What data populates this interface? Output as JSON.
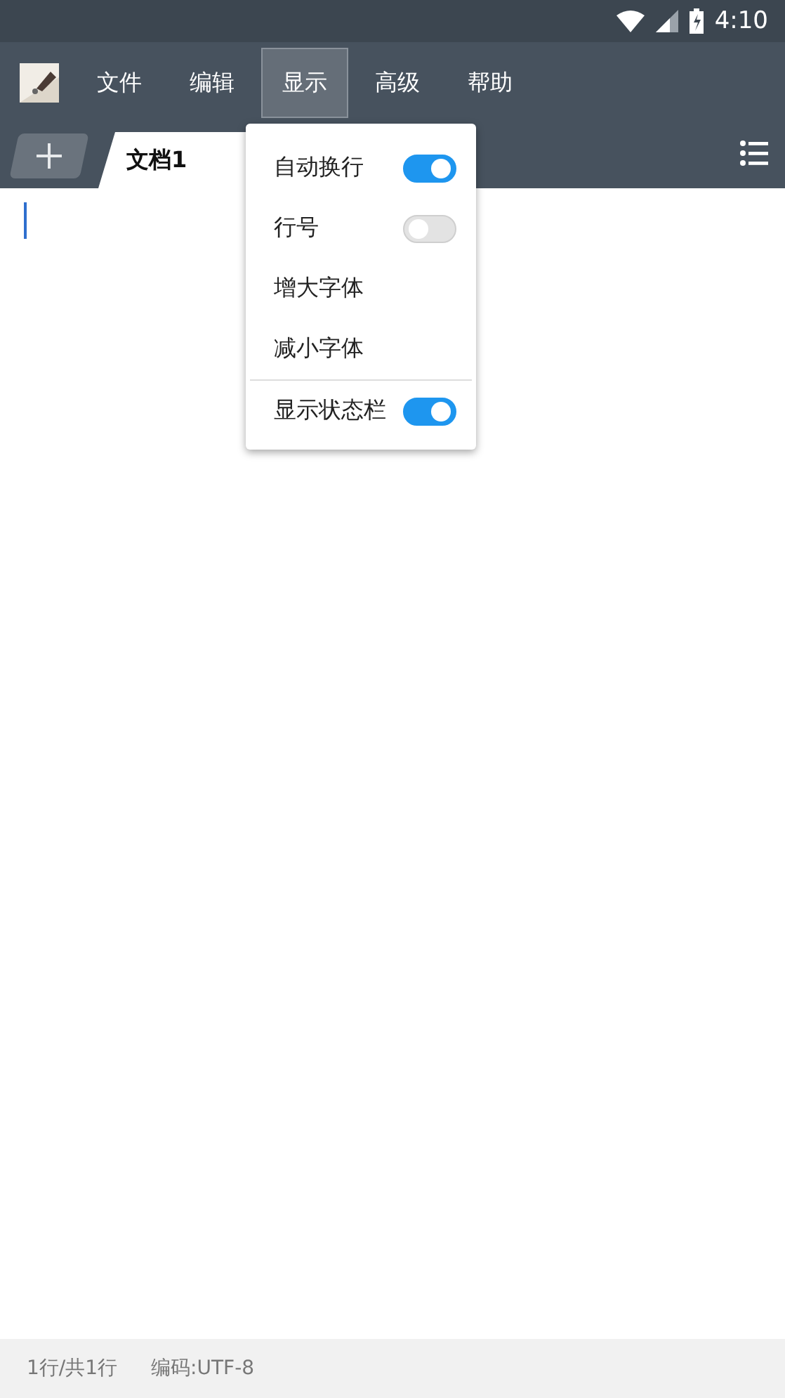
{
  "system_bar": {
    "time": "4:10"
  },
  "menu_bar": {
    "menus": [
      {
        "label": "文件",
        "selected": false
      },
      {
        "label": "编辑",
        "selected": false
      },
      {
        "label": "显示",
        "selected": true
      },
      {
        "label": "高级",
        "selected": false
      },
      {
        "label": "帮助",
        "selected": false
      }
    ]
  },
  "tabs": [
    {
      "label": "文档1",
      "selected": true
    }
  ],
  "dropdown": {
    "items": [
      {
        "kind": "toggle",
        "label": "自动换行",
        "on": true
      },
      {
        "kind": "toggle",
        "label": "行号",
        "on": false
      },
      {
        "kind": "action",
        "label": "增大字体"
      },
      {
        "kind": "action",
        "label": "减小字体"
      },
      {
        "kind": "divider"
      },
      {
        "kind": "toggle",
        "label": "显示状态栏",
        "on": true
      }
    ]
  },
  "status_bar": {
    "position": "1行/共1行",
    "encoding": "编码:UTF-8"
  }
}
